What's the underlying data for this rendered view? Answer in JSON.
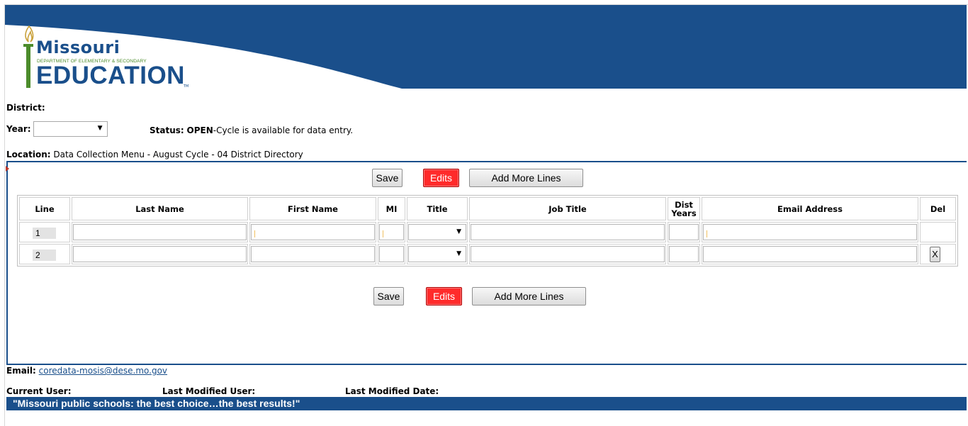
{
  "header": {
    "logo": {
      "state": "Missouri",
      "department": "DEPARTMENT OF ELEMENTARY & SECONDARY",
      "education": "EDUCATION",
      "tm": "TM"
    },
    "brand_color": "#1a4f8b"
  },
  "filters": {
    "district_label": "District:",
    "year_label": "Year:",
    "year_value": "",
    "status_label": "Status:",
    "status_value": "OPEN",
    "status_text": "-Cycle is available for data entry."
  },
  "location": {
    "label": "Location:",
    "path": "Data Collection Menu - August Cycle - 04 District Directory"
  },
  "toolbar": {
    "save_label": "Save",
    "edits_label": "Edits",
    "add_lines_label": "Add More Lines"
  },
  "table": {
    "columns": [
      "Line",
      "Last Name",
      "First Name",
      "MI",
      "Title",
      "Job Title",
      "Dist Years",
      "Email Address",
      "Del"
    ],
    "dist_years_line1": "Dist",
    "dist_years_line2": "Years",
    "rows": [
      {
        "line": "1",
        "last_name": "",
        "first_name": "",
        "mi": "",
        "title": "",
        "job_title": "",
        "dist_years": "",
        "email": "",
        "del": ""
      },
      {
        "line": "2",
        "last_name": "",
        "first_name": "",
        "mi": "",
        "title": "",
        "job_title": "",
        "dist_years": "",
        "email": "",
        "del": "X"
      }
    ]
  },
  "contact": {
    "email_label": "Email:",
    "email_address": "coredata-mosis@dese.mo.gov"
  },
  "users": {
    "current_user_label": "Current User:",
    "last_modified_user_label": "Last Modified User:",
    "last_modified_date_label": "Last Modified Date:"
  },
  "footer": {
    "slogan": "\"Missouri public schools: the best choice…the best results!\""
  }
}
